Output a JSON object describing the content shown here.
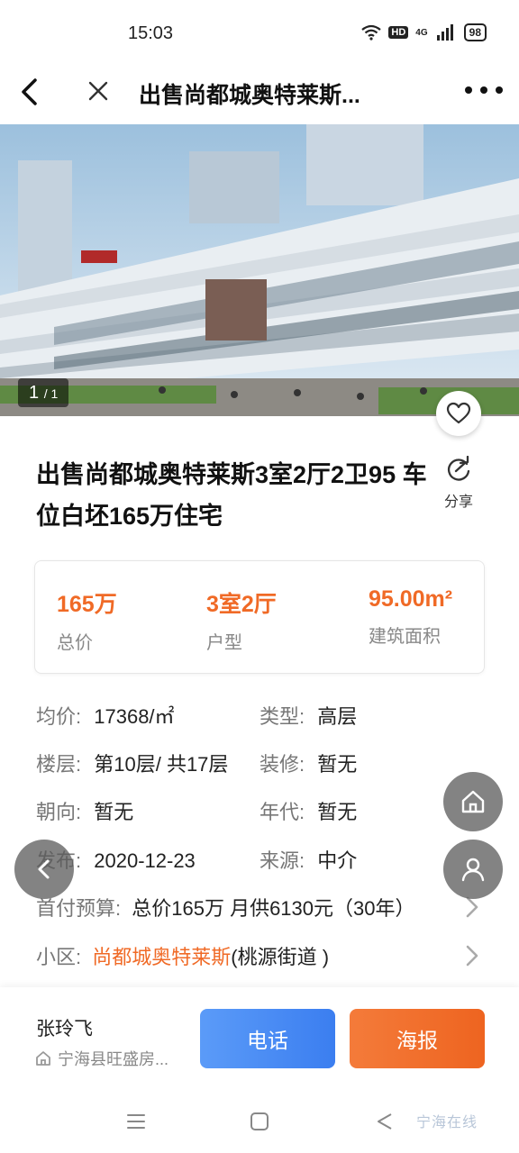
{
  "status_bar": {
    "time": "15:03",
    "hd": "HD",
    "network": "4G",
    "battery": "98"
  },
  "header": {
    "title": "出售尚都城奥特莱斯..."
  },
  "gallery": {
    "index": "1",
    "total": "/ 1"
  },
  "listing": {
    "title": "出售尚都城奥特莱斯3室2厅2卫95 车位白坯165万住宅",
    "share_label": "分享"
  },
  "summary": [
    {
      "value": "165万",
      "label": "总价"
    },
    {
      "value": "3室2厅",
      "label": "户型"
    },
    {
      "value": "95.00m²",
      "label": "建筑面积"
    }
  ],
  "attributes": {
    "avg_price_key": "均价:",
    "avg_price_val": "17368/㎡",
    "type_key": "类型:",
    "type_val": "高层",
    "floor_key": "楼层:",
    "floor_val": "第10层/ 共17层",
    "decor_key": "装修:",
    "decor_val": "暂无",
    "orient_key": "朝向:",
    "orient_val": "暂无",
    "year_key": "年代:",
    "year_val": "暂无",
    "publish_key": "发布:",
    "publish_val": "2020-12-23",
    "source_key": "来源:",
    "source_val": "中介",
    "budget_key": "首付预算:",
    "budget_val": "总价165万 月供6130元（30年）",
    "community_key": "小区:",
    "community_name": "尚都城奥特莱斯",
    "community_street": "(桃源街道 )"
  },
  "agent": {
    "name": "张玲飞",
    "company": "宁海县旺盛房..."
  },
  "actions": {
    "call": "电话",
    "poster": "海报"
  },
  "watermark": "宁海在线",
  "colors": {
    "accent": "#f06a26",
    "call": "#4a8df5",
    "poster": "#f06a26"
  }
}
